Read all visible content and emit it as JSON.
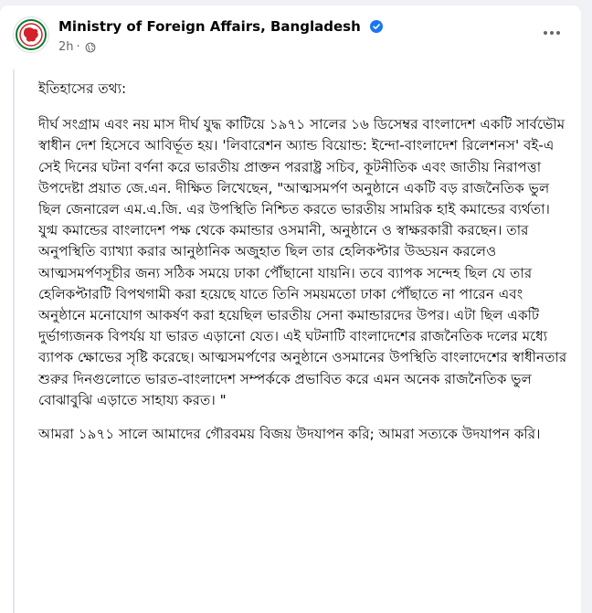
{
  "post": {
    "page_name": "Ministry of Foreign Affairs, Bangladesh",
    "time": "2h",
    "separator": "·",
    "more_label": "•••",
    "heading": "ইতিহাসের তথ্য:",
    "paragraph_1": "দীর্ঘ সংগ্রাম এবং নয় মাস দীর্ঘ যুদ্ধ কাটিয়ে ১৯৭১ সালের ১৬ ডিসেম্বর বাংলাদেশ একটি সার্বভৌম স্বাধীন দেশ হিসেবে আবির্ভূত হয়। 'লিবারেশন অ্যান্ড বিয়োন্ড: ইন্দো-বাংলাদেশ রিলেশনস' বই-এ সেই দিনের ঘটনা বর্ণনা করে ভারতীয় প্রাক্তন পররাষ্ট্র সচিব, কূটনীতিক এবং জাতীয় নিরাপত্তা উপদেষ্টা প্রয়াত জে.এন. দীক্ষিত লিখেছেন, \"আত্মসমর্পণ অনুষ্ঠানে একটি বড় রাজনৈতিক ভুল ছিল জেনারেল এম.এ.জি. এর উপস্থিতি নিশ্চিত করতে ভারতীয় সামরিক হাই কমান্ডের ব্যর্থতা। যুগ্ম কমান্ডের বাংলাদেশ পক্ষ থেকে কমান্ডার ওসমানী, অনুষ্ঠানে ও স্বাক্ষরকারী করছেন। তার অনুপস্থিতি ব্যাখ্যা করার আনুষ্ঠানিক অজুহাত ছিল তার হেলিকপ্টার উড্ডয়ন করলেও আত্মসমর্পণসূচীর জন্য সঠিক সময়ে ঢাকা পৌঁছানো যায়নি। তবে ব্যাপক সন্দেহ ছিল যে তার হেলিকপ্টারটি বিপথগামী করা হয়েছে যাতে তিনি সময়মতো ঢাকা পৌঁছাতে না পারেন এবং অনুষ্ঠানে মনোযোগ আকর্ষণ করা হয়েছিল ভারতীয় সেনা কমান্ডারদের উপর। এটা ছিল একটি দুর্ভাগ্যজনক বিপর্যয় যা ভারত এড়ানো যেত। এই ঘটনাটি বাংলাদেশের রাজনৈতিক দলের মধ্যে ব্যাপক ক্ষোভের সৃষ্টি করেছে। আত্মসমর্পণের অনুষ্ঠানে ওসমানের উপস্থিতি বাংলাদেশের স্বাধীনতার শুরুর দিনগুলোতে ভারত-বাংলাদেশ সম্পর্ককে প্রভাবিত করে এমন অনেক রাজনৈতিক ভুল বোঝাবুঝি এড়াতে সাহায্য করত। \"",
    "paragraph_2": "আমরা ১৯৭১ সালে আমাদের গৌরবময় বিজয় উদযাপন করি; আমরা সত্যকে উদযাপন করি।"
  },
  "colors": {
    "verified_badge": "#1877f2",
    "secondary_text": "#65676b",
    "emblem_green": "#0a7a33",
    "emblem_red": "#d42027"
  },
  "icons": {
    "avatar": "ministry-emblem-icon",
    "verified": "verified-badge-icon",
    "audience": "globe-icon",
    "menu": "more-options-icon"
  }
}
